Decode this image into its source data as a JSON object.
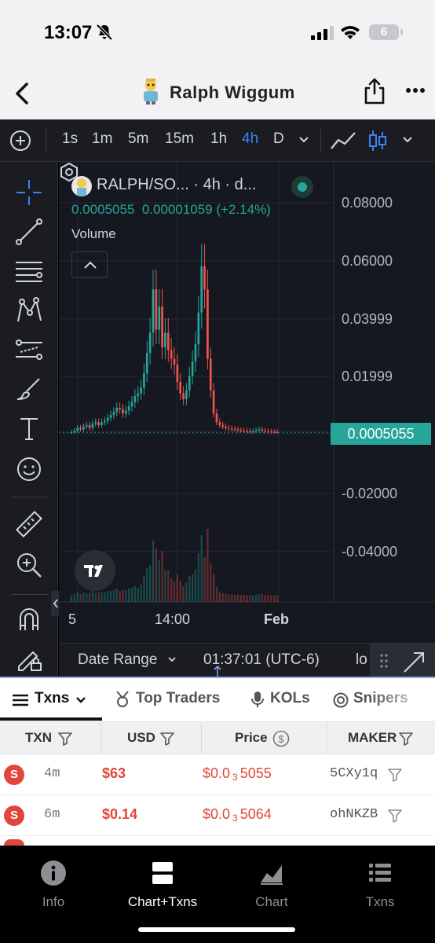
{
  "status_bar": {
    "time": "13:07",
    "battery": "6"
  },
  "header": {
    "title": "Ralph Wiggum"
  },
  "timeframes": [
    {
      "label": "1s",
      "active": false
    },
    {
      "label": "1m",
      "active": false
    },
    {
      "label": "5m",
      "active": false
    },
    {
      "label": "15m",
      "active": false
    },
    {
      "label": "1h",
      "active": false
    },
    {
      "label": "4h",
      "active": true
    },
    {
      "label": "D",
      "active": false
    }
  ],
  "chart": {
    "pair": "RALPH/SO...",
    "interval": "· 4h · d...",
    "last_price": "0.0005055",
    "change": "0.00001059",
    "change_pct": "(+2.14%)",
    "volume_label": "Volume",
    "current_price_tag": "0.0005055",
    "y_ticks": [
      "0.08000",
      "0.06000",
      "0.03999",
      "0.01999",
      "-0.02000",
      "-0.04000"
    ],
    "x_ticks": [
      "5",
      "14:00",
      "Feb"
    ],
    "up_color": "#26a69a",
    "down_color": "#ef5350"
  },
  "chart_data": {
    "type": "candlestick",
    "title": "RALPH/SO... · 4h · d...",
    "x_ticks": [
      "5",
      "14:00",
      "Feb"
    ],
    "ylim": [
      -0.05,
      0.09
    ],
    "last": 0.0005055,
    "approx_close_series": [
      0.0005,
      0.001,
      0.002,
      0.0015,
      0.0025,
      0.003,
      0.002,
      0.0035,
      0.004,
      0.003,
      0.004,
      0.0045,
      0.0055,
      0.0065,
      0.0075,
      0.009,
      0.0085,
      0.007,
      0.008,
      0.0095,
      0.011,
      0.013,
      0.014,
      0.016,
      0.021,
      0.028,
      0.035,
      0.05,
      0.036,
      0.044,
      0.03,
      0.035,
      0.029,
      0.026,
      0.024,
      0.018,
      0.014,
      0.012,
      0.015,
      0.02,
      0.025,
      0.031,
      0.042,
      0.058,
      0.05,
      0.026,
      0.015,
      0.007,
      0.004,
      0.003,
      0.0025,
      0.002,
      0.0018,
      0.0016,
      0.0015,
      0.0012,
      0.0011,
      0.001,
      0.0009,
      0.0008,
      0.0009,
      0.0012,
      0.0015,
      0.0011,
      0.0009,
      0.0008,
      0.0007,
      0.0006,
      0.0005055
    ]
  },
  "range_bar": {
    "label": "Date Range",
    "clock": "01:37:01 (UTC-6)",
    "extra": "lo"
  },
  "txn_tabs": [
    {
      "label": "Txns",
      "active": true
    },
    {
      "label": "Top Traders",
      "active": false
    },
    {
      "label": "KOLs",
      "active": false
    },
    {
      "label": "Snipers",
      "active": false
    }
  ],
  "table": {
    "headers": [
      "TXN",
      "USD",
      "Price",
      "MAKER"
    ],
    "rows": [
      {
        "type": "S",
        "age": "4m",
        "usd": "$63",
        "price_prefix": "$0.0",
        "price_zeros": "3",
        "price_digits": "5055",
        "maker": "5CXy1q"
      },
      {
        "type": "S",
        "age": "6m",
        "usd": "$0.14",
        "price_prefix": "$0.0",
        "price_zeros": "3",
        "price_digits": "5064",
        "maker": "ohNKZB"
      }
    ]
  },
  "bottom_tabs": [
    {
      "label": "Info",
      "icon": "info-icon",
      "active": false
    },
    {
      "label": "Chart+Txns",
      "icon": "split-view-icon",
      "active": true
    },
    {
      "label": "Chart",
      "icon": "area-chart-icon",
      "active": false
    },
    {
      "label": "Txns",
      "icon": "list-icon",
      "active": false
    }
  ]
}
